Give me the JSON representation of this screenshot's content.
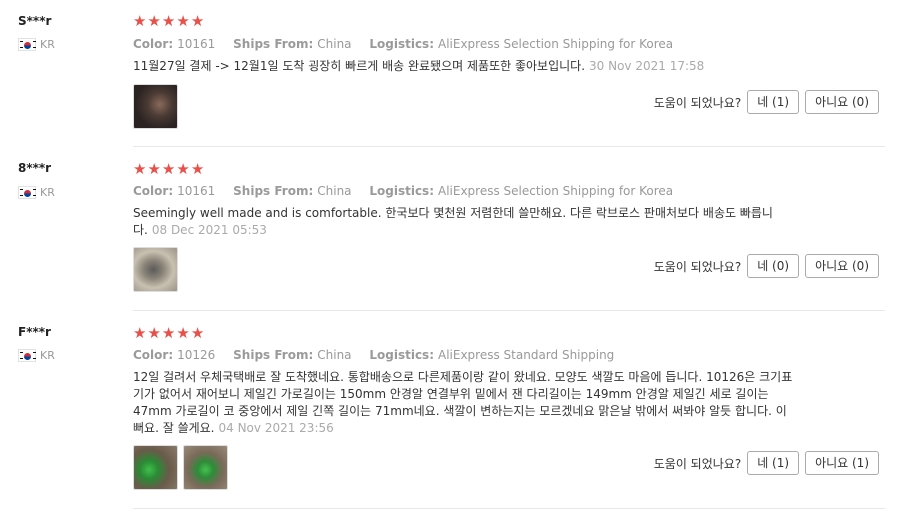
{
  "helpful_prompt": "도움이 되었나요?",
  "color_label": "Color:",
  "ships_label": "Ships From:",
  "logistics_label": "Logistics:",
  "reviews": [
    {
      "name": "S***r",
      "country": "KR",
      "stars": 5,
      "color": "10161",
      "ships_from": "China",
      "logistics": "AliExpress Selection Shipping for Korea",
      "text": "11월27일 결제 -> 12월1일 도착 굉장히 빠르게 배송 완료됐으며 제품또한 좋아보입니다.",
      "date": "30 Nov 2021 17:58",
      "yes": "네 (1)",
      "no": "아니요 (0)"
    },
    {
      "name": "8***r",
      "country": "KR",
      "stars": 5,
      "color": "10161",
      "ships_from": "China",
      "logistics": "AliExpress Selection Shipping for Korea",
      "text": "Seemingly well made and is comfortable. 한국보다 몇천원 저렴한데 쓸만해요. 다른 락브로스 판매처보다 배송도 빠릅니다.",
      "date": "08 Dec 2021 05:53",
      "yes": "네 (0)",
      "no": "아니요 (0)"
    },
    {
      "name": "F***r",
      "country": "KR",
      "stars": 5,
      "color": "10126",
      "ships_from": "China",
      "logistics": "AliExpress Standard Shipping",
      "text": "12일 걸려서 우체국택배로 잘 도착했네요. 통합배송으로 다른제품이랑 같이 왔네요. 모양도 색깔도 마음에 듭니다. 10126은 크기표기가 없어서 재어보니 제일긴 가로길이는 150mm 안경알 연결부위 밑에서 잰 다리길이는 149mm 안경알 제일긴 세로 길이는 47mm 가로길이 코 중앙에서 제일 긴쪽 길이는 71mm네요. 색깔이 변하는지는 모르겠네요 맑은날 밖에서 써봐야 알듯 합니다. 이뻐요. 잘 쓸게요.",
      "date": "04 Nov 2021 23:56",
      "yes": "네 (1)",
      "no": "아니요 (1)"
    }
  ],
  "colors": {
    "star": "#e8504a",
    "meta": "#999999",
    "divider": "#e8e8e8"
  }
}
